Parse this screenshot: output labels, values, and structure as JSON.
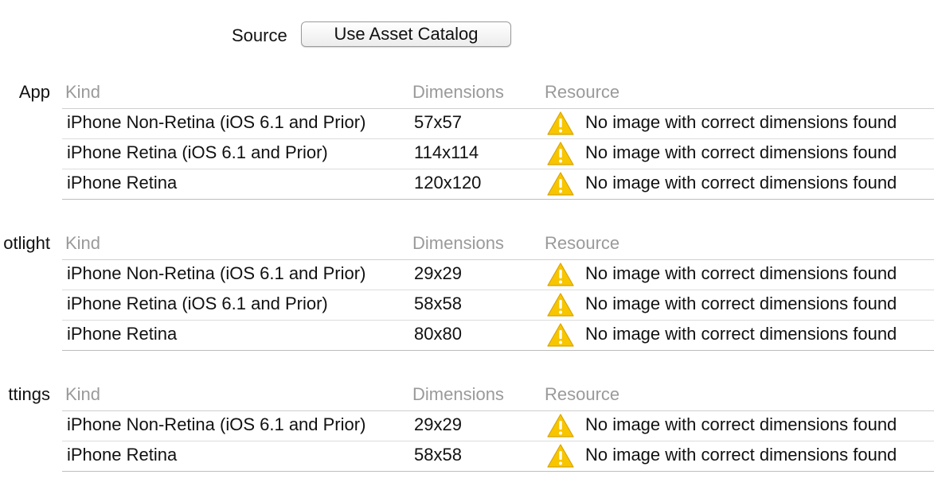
{
  "source": {
    "label": "Source",
    "button_label": "Use Asset Catalog"
  },
  "columns": {
    "kind": "Kind",
    "dimensions": "Dimensions",
    "resource": "Resource"
  },
  "sections": [
    {
      "label": "App",
      "rows": [
        {
          "kind": "iPhone Non-Retina (iOS 6.1 and Prior)",
          "dimensions": "57x57",
          "resource": "No image with correct dimensions found"
        },
        {
          "kind": "iPhone Retina (iOS 6.1 and Prior)",
          "dimensions": "114x114",
          "resource": "No image with correct dimensions found"
        },
        {
          "kind": "iPhone Retina",
          "dimensions": "120x120",
          "resource": "No image with correct dimensions found"
        }
      ]
    },
    {
      "label": "otlight",
      "rows": [
        {
          "kind": "iPhone Non-Retina (iOS 6.1 and Prior)",
          "dimensions": "29x29",
          "resource": "No image with correct dimensions found"
        },
        {
          "kind": "iPhone Retina (iOS 6.1 and Prior)",
          "dimensions": "58x58",
          "resource": "No image with correct dimensions found"
        },
        {
          "kind": "iPhone Retina",
          "dimensions": "80x80",
          "resource": "No image with correct dimensions found"
        }
      ]
    },
    {
      "label": "ttings",
      "rows": [
        {
          "kind": "iPhone Non-Retina (iOS 6.1 and Prior)",
          "dimensions": "29x29",
          "resource": "No image with correct dimensions found"
        },
        {
          "kind": "iPhone Retina",
          "dimensions": "58x58",
          "resource": "No image with correct dimensions found"
        }
      ]
    }
  ],
  "icons": {
    "warning": "warning-triangle-icon"
  },
  "colors": {
    "warning_fill": "#f7c600",
    "warning_mark": "#ffffff",
    "header_text": "#9a9a9a",
    "row_text": "#111111",
    "divider": "#cfcfcf"
  }
}
